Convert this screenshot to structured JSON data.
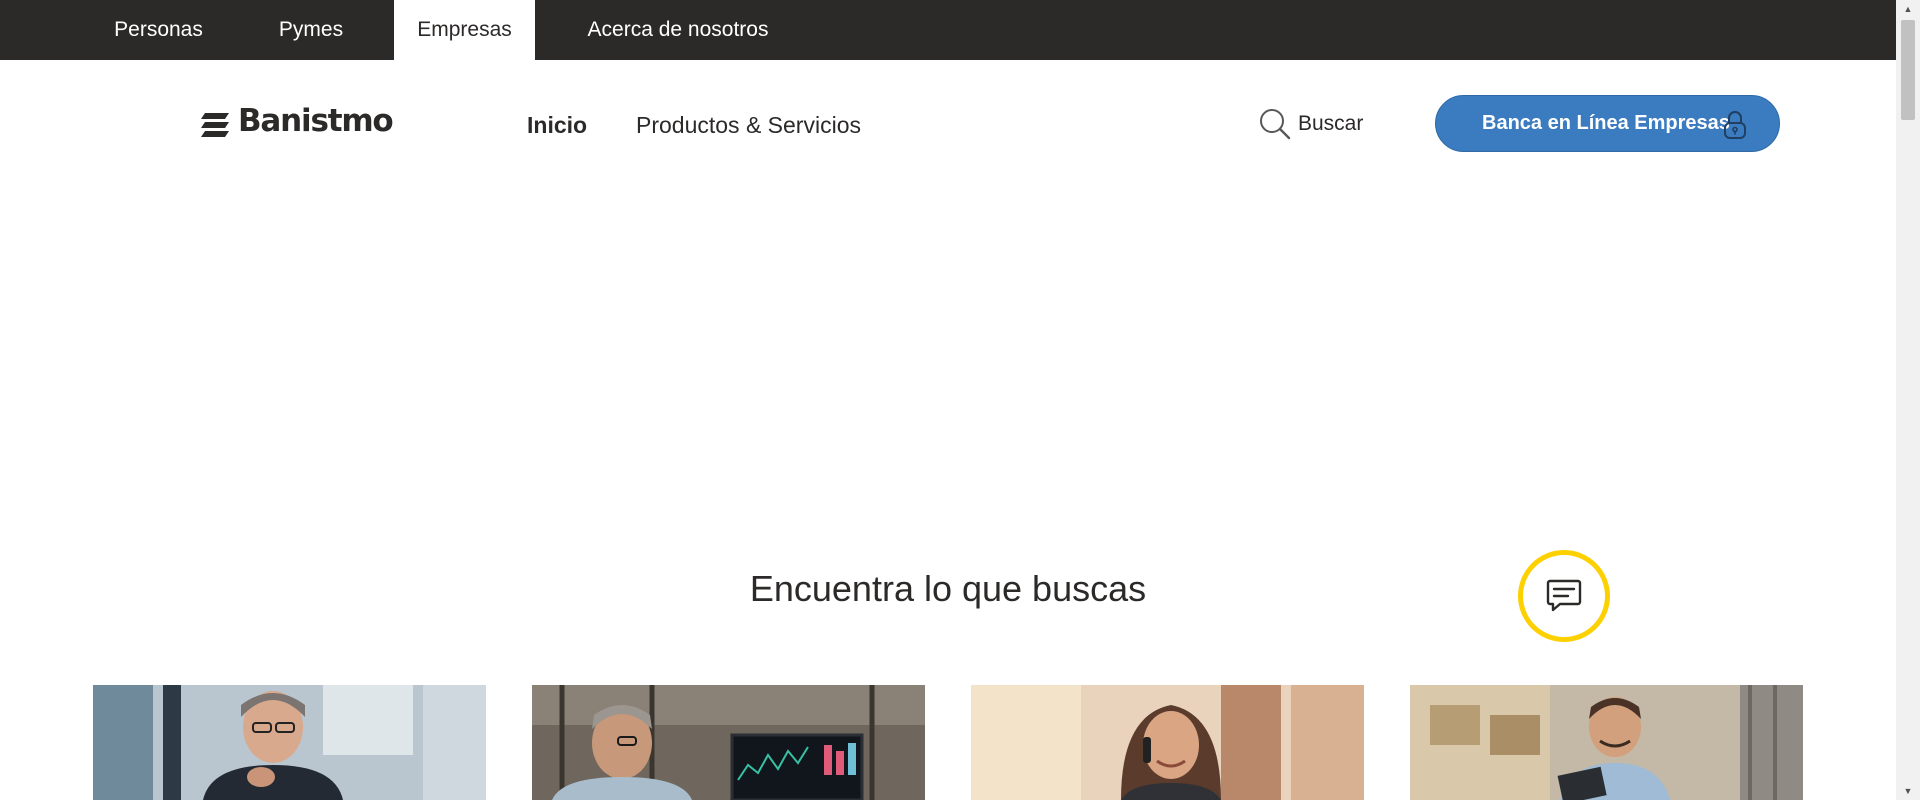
{
  "segments": [
    {
      "label": "Personas",
      "active": false
    },
    {
      "label": "Pymes",
      "active": false
    },
    {
      "label": "Empresas",
      "active": true
    },
    {
      "label": "Acerca de nosotros",
      "active": false
    }
  ],
  "header": {
    "logo_text": "Banistmo",
    "nav": [
      {
        "label": "Inicio"
      },
      {
        "label": "Productos & Servicios"
      }
    ],
    "search_label": "Buscar",
    "cta_label": "Banca en Línea Empresas"
  },
  "section": {
    "title": "Encuentra lo que buscas"
  },
  "chat": {
    "icon": "chat-bubble-icon",
    "ring_color": "#fdd000"
  },
  "cards": [
    {
      "image": "businessman-with-glasses-photo"
    },
    {
      "image": "man-at-trading-monitor-photo"
    },
    {
      "image": "woman-on-phone-photo"
    },
    {
      "image": "man-with-tablet-in-warehouse-photo"
    }
  ],
  "colors": {
    "topbar": "#2c2a29",
    "accent": "#3b7bbf",
    "text": "#2c2a29",
    "chat_ring": "#fdd000"
  }
}
